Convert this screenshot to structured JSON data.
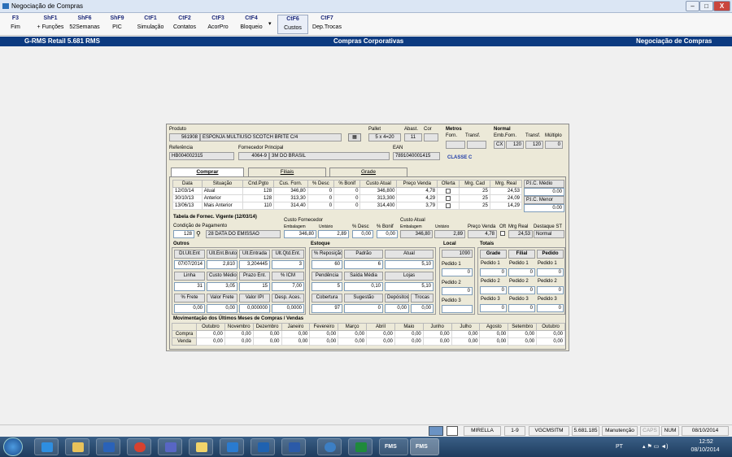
{
  "window": {
    "title": "Negociação de Compras",
    "min": "–",
    "max": "□",
    "close": "X"
  },
  "toolbar": [
    {
      "key": "F3",
      "label": "Fim"
    },
    {
      "key": "ShF1",
      "label": "+ Funções"
    },
    {
      "key": "ShF6",
      "label": "52Semanas"
    },
    {
      "key": "ShF9",
      "label": "PIC"
    },
    {
      "key": "CtF1",
      "label": "Simulação"
    },
    {
      "key": "CtF2",
      "label": "Contatos"
    },
    {
      "key": "CtF3",
      "label": "AcorPro"
    },
    {
      "key": "CtF4",
      "label": "Bloqueio"
    },
    {
      "key": "CtF6",
      "label": "Custos"
    },
    {
      "key": "CtF7",
      "label": "Dep.Trocas"
    }
  ],
  "header": {
    "left": "G-RMS Retail 5.681 RMS",
    "center": "Compras Corporativas",
    "right": "Negociação de Compras"
  },
  "product": {
    "produto_label": "Produto",
    "codigo": "561908",
    "descricao": "ESPONJA MULTIUSO SCOTCH BRITE C/4",
    "pallet_label": "Pallet",
    "pallet": "5 x 4=20",
    "abast_label": "Abast.",
    "abast": "11",
    "cor_label": "Cor",
    "cor": "",
    "referencia_label": "Referência",
    "referencia": "HB004002315",
    "fornecedor_label": "Fornecedor Principal",
    "fornecedor_cod": "4064-9",
    "fornecedor_nome": "3M DO BRASIL",
    "ean_label": "EAN",
    "ean": "7891040001415",
    "metros_label": "Metros",
    "forn_label": "Forn.",
    "transf_label": "Transf.",
    "normal_label": "Normal",
    "emb_forn_label": "Emb.Forn.",
    "transf2_label": "Transf.",
    "multiplo_label": "Múltiplo",
    "emb_un": "CX",
    "emb_forn": "120",
    "transf": "120",
    "multiplo": "0",
    "classe": "CLASSE C"
  },
  "tabs": [
    "Comprar",
    "Filiais",
    "Grade"
  ],
  "history": {
    "columns": [
      "Data",
      "Situação",
      "Cnd.Pgto",
      "Cus. Forn.",
      "% Desc",
      "% Bonif",
      "Custo Atual",
      "Preço Venda",
      "Oferta",
      "Mrg. Cad",
      "Mrg. Real"
    ],
    "rows": [
      [
        "12/03/14",
        "Atual",
        "128",
        "346,80",
        "0",
        "0",
        "346,800",
        "4,78",
        "",
        "25",
        "24,53"
      ],
      [
        "30/10/13",
        "Anterior",
        "128",
        "313,30",
        "0",
        "0",
        "313,300",
        "4,29",
        "",
        "25",
        "24,09"
      ],
      [
        "13/06/13",
        "Mais Anterior",
        "110",
        "314,40",
        "0",
        "0",
        "314,400",
        "3,79",
        "",
        "25",
        "14,29"
      ]
    ],
    "pic_medio_label": "P.I.C. Médio",
    "pic_medio": "0.00",
    "pic_menor_label": "P.I.C. Menor",
    "pic_menor": "0.00"
  },
  "tabela": {
    "title": "Tabela de Fornec. Vigente (12/03/14)",
    "cond_label": "Condição de Pagamento",
    "cond_cod": "128",
    "cond_desc": "28 DATA DO EMISSAO",
    "custo_forn_label": "Custo Fornecedor",
    "embalagem_label": "Embalagem",
    "unitario_label": "Unitário",
    "custo_emb": "346,80",
    "custo_unit": "2,89",
    "desc_label": "% Desc",
    "desc": "0,00",
    "bonif_label": "% Bonif",
    "bonif": "0,00",
    "custo_atual_label": "Custo Atual",
    "emb2_label": "Embalagem",
    "unit2_label": "Unitário",
    "custo_atual_emb": "346,80",
    "custo_atual_unit": "2,89",
    "preco_venda_label": "Preço Venda",
    "preco_venda": "4,78",
    "oft_label": "Oft",
    "mrg_real_label": "Mrg Real",
    "mrg_real": "24,53",
    "destaque_label": "Destaque ST",
    "destaque": "Normal"
  },
  "outros": {
    "title": "Outros",
    "r1h": [
      "Dt.Últ.Ent",
      "Últ.Ent.Bruto",
      "Últ.Entrada",
      "Últ.Qtd.Ent."
    ],
    "r1v": [
      "07/07/2014",
      "2,810",
      "3,204445",
      "3"
    ],
    "r2h": [
      "Linha",
      "Custo Médio",
      "Prazo Ent.",
      "% ICM"
    ],
    "r2v": [
      "31",
      "3,05",
      "15",
      "7,00"
    ],
    "r3h": [
      "% Frete",
      "Valor Frete",
      "Valor IPI",
      "Desp. Aces."
    ],
    "r3v": [
      "0,00",
      "0,00",
      "0,000000",
      "0,0000"
    ]
  },
  "estoque": {
    "title": "Estoque",
    "r1h": [
      "% Reposição",
      "Padrão",
      "Atual"
    ],
    "r1v": [
      "60",
      "6",
      "5,10"
    ],
    "r2h": [
      "Pendência",
      "Saída Média",
      "Lojas"
    ],
    "r2v": [
      "5",
      "0,10",
      "5,10"
    ],
    "r3h": [
      "Cobertura",
      "Sugestão",
      "Depósitos",
      "Trocas"
    ],
    "r3v": [
      "97",
      "0",
      "0,00",
      "0,00"
    ]
  },
  "local": {
    "title": "Local",
    "value": "1090",
    "p1_label": "Pedido 1",
    "p1": "0",
    "p2_label": "Pedido 2",
    "p2": "0",
    "p3_label": "Pedido 3",
    "p3": ""
  },
  "totais": {
    "title": "Totais",
    "cols": [
      "Grade",
      "Filial",
      "Pedido"
    ],
    "rows": [
      {
        "labels": [
          "Pedido 1",
          "Pedido 1",
          "Pedido 1"
        ],
        "values": [
          "0",
          "0",
          "0"
        ]
      },
      {
        "labels": [
          "Pedido 2",
          "Pedido 2",
          "Pedido 2"
        ],
        "values": [
          "0",
          "0",
          "0"
        ]
      },
      {
        "labels": [
          "Pedido 3",
          "Pedido 3",
          "Pedido 3"
        ],
        "values": [
          "0",
          "0",
          "0"
        ]
      }
    ]
  },
  "movimentacao": {
    "title": "Movimentação dos Últimos Meses de Compras / Vendas",
    "months": [
      "Outubro",
      "Novembro",
      "Dezembro",
      "Janeiro",
      "Fevereiro",
      "Março",
      "Abril",
      "Maio",
      "Junho",
      "Julho",
      "Agosto",
      "Setembro",
      "Outubro"
    ],
    "compra_label": "Compra",
    "venda_label": "Venda",
    "compra": [
      "0,00",
      "0,00",
      "0,00",
      "0,00",
      "0,00",
      "0,00",
      "0,00",
      "0,00",
      "0,00",
      "0,00",
      "0,00",
      "0,00",
      "0,00"
    ],
    "venda": [
      "0,00",
      "0,00",
      "0,00",
      "0,00",
      "0,00",
      "0,00",
      "0,00",
      "0,00",
      "0,00",
      "0,00",
      "0,00",
      "0,00",
      "0,00"
    ]
  },
  "status": [
    "MIRELLA",
    "1-9",
    "VGCMSITM",
    "5.681.185",
    "Manutenção",
    "CAPS",
    "NUM",
    "08/10/2014"
  ],
  "clock": {
    "time": "12:52",
    "date": "08/10/2014",
    "lang": "PT"
  },
  "taskbar_labels": {
    "fms1": "FMS",
    "fms2": "FMS"
  }
}
